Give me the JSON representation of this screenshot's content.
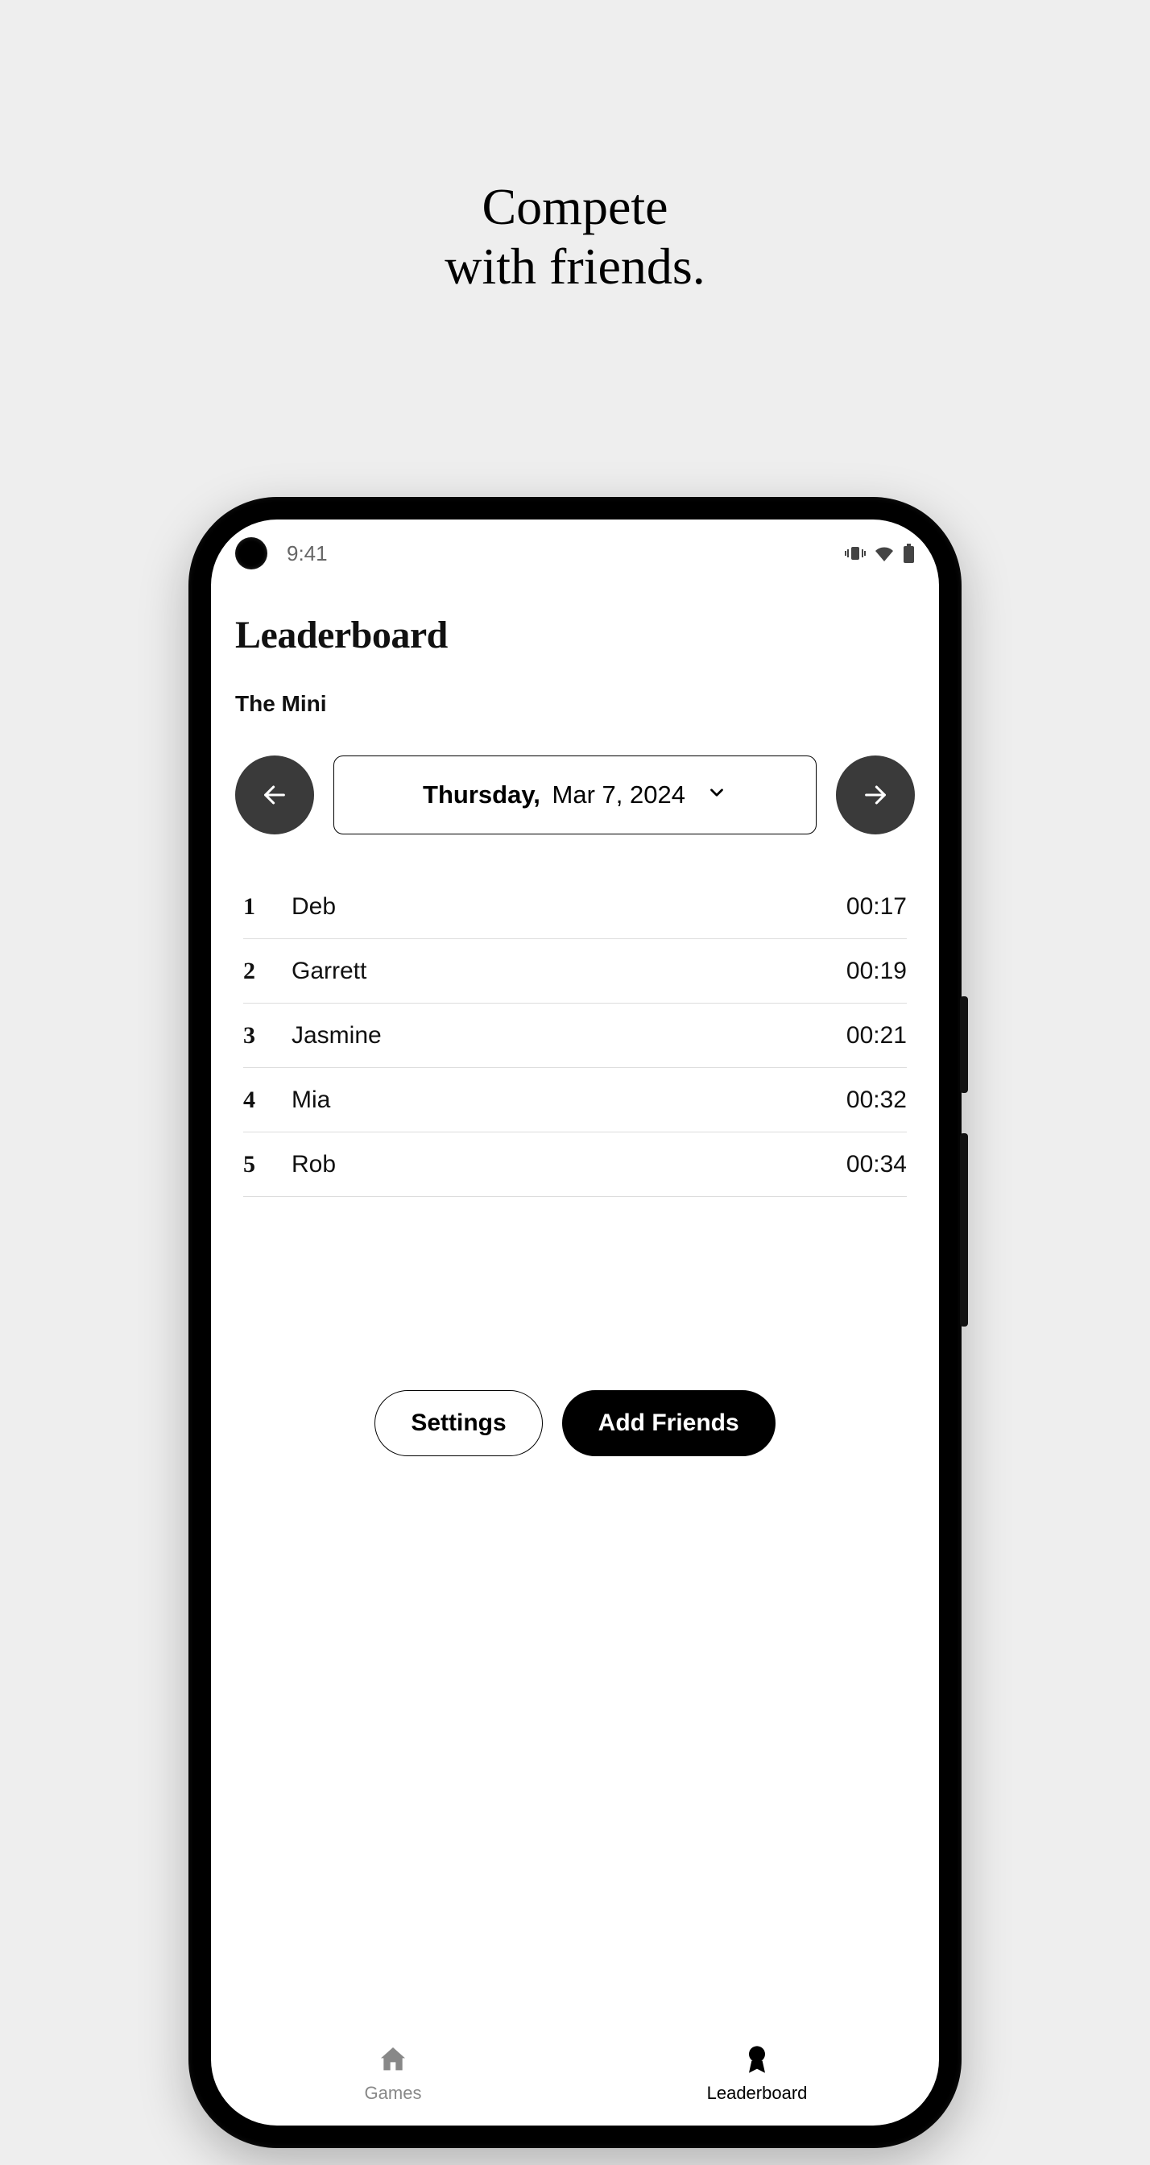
{
  "promo": {
    "line1": "Compete",
    "line2": "with friends."
  },
  "status": {
    "time": "9:41"
  },
  "header": {
    "title": "Leaderboard",
    "subtitle": "The Mini"
  },
  "date_picker": {
    "dow": "Thursday,",
    "rest": "Mar 7, 2024"
  },
  "leaderboard": [
    {
      "rank": "1",
      "name": "Deb",
      "time": "00:17"
    },
    {
      "rank": "2",
      "name": "Garrett",
      "time": "00:19"
    },
    {
      "rank": "3",
      "name": "Jasmine",
      "time": "00:21"
    },
    {
      "rank": "4",
      "name": "Mia",
      "time": "00:32"
    },
    {
      "rank": "5",
      "name": "Rob",
      "time": "00:34"
    }
  ],
  "actions": {
    "settings": "Settings",
    "add_friends": "Add Friends"
  },
  "bottom_nav": {
    "games": "Games",
    "leaderboard": "Leaderboard"
  }
}
